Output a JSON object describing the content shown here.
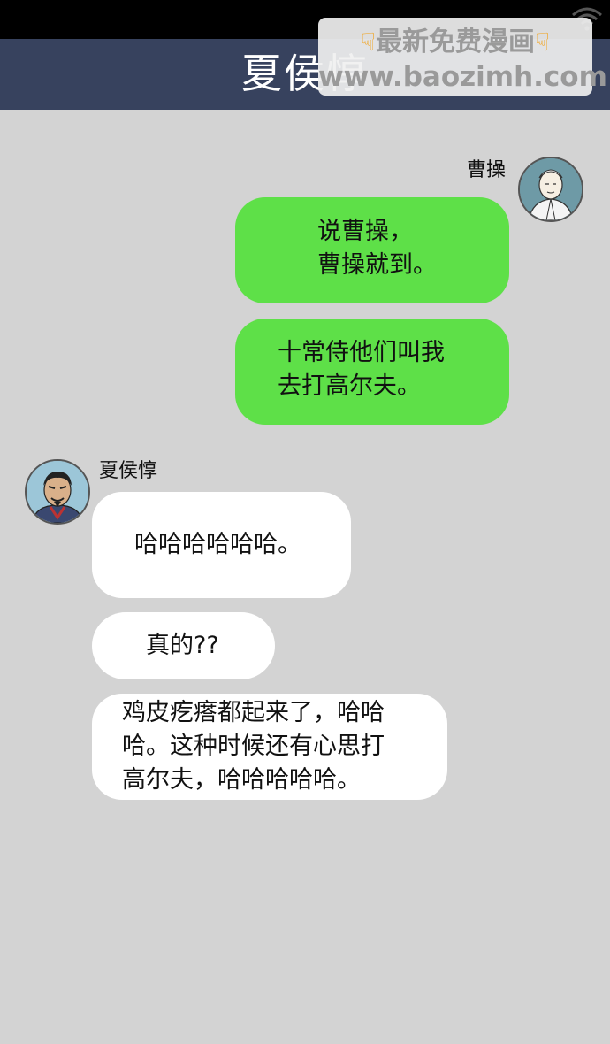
{
  "header": {
    "title": "夏侯惇"
  },
  "watermark": {
    "line1": "最新免费漫画",
    "line2": "www.baozimh.com",
    "icon": "pointing-down-hand"
  },
  "contacts": {
    "caocao": {
      "name": "曹操",
      "avatar": "caocao-avatar"
    },
    "xiahoudun": {
      "name": "夏侯惇",
      "avatar": "xiahoudun-avatar"
    }
  },
  "messages": {
    "m1": {
      "lines": [
        "说曹操，",
        "曹操就到。"
      ]
    },
    "m2": {
      "lines": [
        "十常侍他们叫我",
        "去打高尔夫。"
      ]
    },
    "m3": {
      "lines": [
        "哈哈哈哈哈哈。"
      ]
    },
    "m4": {
      "lines": [
        "真的??"
      ]
    },
    "m5": {
      "lines": [
        "鸡皮疙瘩都起来了，哈哈",
        "哈。这种时候还有心思打",
        "高尔夫，哈哈哈哈哈。"
      ]
    }
  },
  "colors": {
    "sent_bubble": "#5ee048",
    "received_bubble": "#ffffff",
    "title_bar": "#37425e",
    "background": "#d3d3d3"
  }
}
